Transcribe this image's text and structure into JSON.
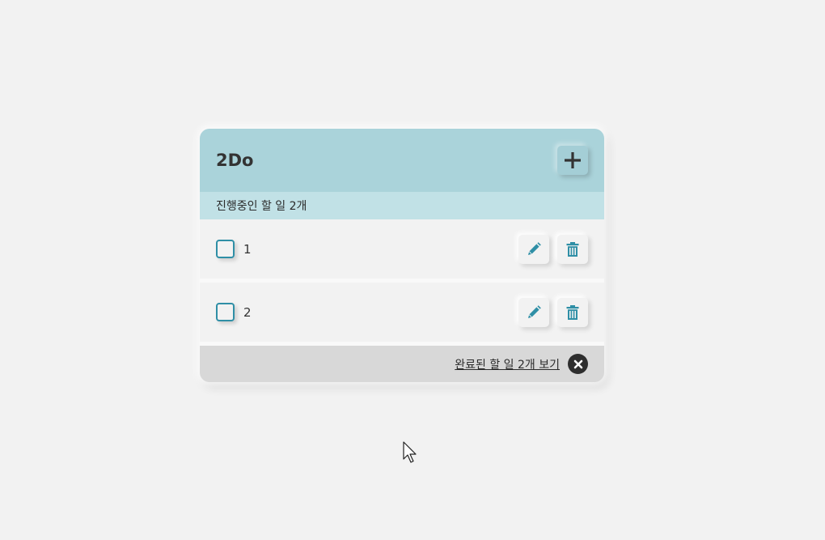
{
  "header": {
    "title": "2Do",
    "add_icon": "plus-icon"
  },
  "status": {
    "text": "진행중인 할 일 2개"
  },
  "todos": [
    {
      "text": "1",
      "checked": false
    },
    {
      "text": "2",
      "checked": false
    }
  ],
  "footer": {
    "completed_link": "완료된 할 일 2개 보기",
    "close_icon": "close-icon"
  },
  "colors": {
    "header_bg": "#aad3da",
    "subheader_bg": "#c1e1e6",
    "accent": "#2f8fa6",
    "footer_bg": "#d8d8d8",
    "page_bg": "#f2f2f2"
  }
}
